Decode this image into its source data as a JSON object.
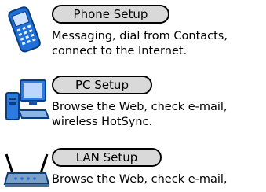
{
  "sections": [
    {
      "button": "Phone Setup",
      "line1": "Messaging, dial from Contacts,",
      "line2": "connect to the Internet.",
      "icon": "phone-icon"
    },
    {
      "button": "PC Setup",
      "line1": "Browse the Web, check e-mail,",
      "line2": "wireless HotSync.",
      "icon": "computer-icon"
    },
    {
      "button": "LAN Setup",
      "line1": "Browse the Web, check e-mail,",
      "line2": "",
      "icon": "router-icon"
    }
  ],
  "colors": {
    "button_fill": "#d9d9d9",
    "phone_body": "#1e6fd9",
    "computer_body": "#2d7be0",
    "router_body": "#7aa0c8"
  }
}
